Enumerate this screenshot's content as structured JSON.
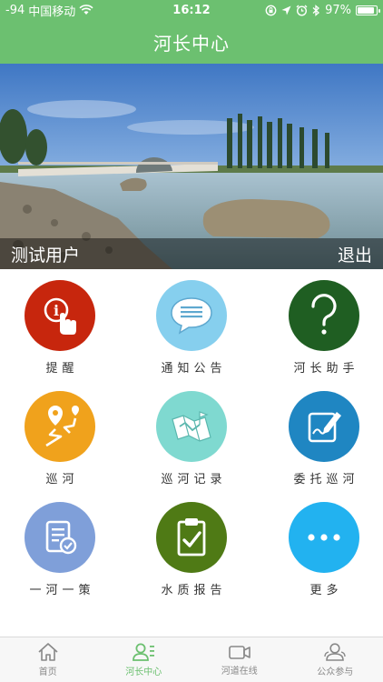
{
  "status_bar": {
    "signal": "-94",
    "carrier": "中国移动",
    "time": "16:12",
    "battery": "97%",
    "battery_level": 0.97
  },
  "header": {
    "title": "河长中心"
  },
  "banner": {
    "username": "测试用户",
    "logout_label": "退出"
  },
  "menu": [
    {
      "label": "提醒",
      "icon": "reminder-hand-icon",
      "color": "#c7260d"
    },
    {
      "label": "通知公告",
      "icon": "chat-bubble-icon",
      "color": "#86cfee"
    },
    {
      "label": "河长助手",
      "icon": "question-mark-icon",
      "color": "#1f5e22"
    },
    {
      "label": "巡河",
      "icon": "route-map-icon",
      "color": "#f0a21c"
    },
    {
      "label": "巡河记录",
      "icon": "folded-map-icon",
      "color": "#7fd9d0"
    },
    {
      "label": "委托巡河",
      "icon": "edit-note-icon",
      "color": "#1f86c2"
    },
    {
      "label": "一河一策",
      "icon": "checklist-icon",
      "color": "#7f9fd9"
    },
    {
      "label": "水质报告",
      "icon": "clipboard-check-icon",
      "color": "#4f7a15"
    },
    {
      "label": "更多",
      "icon": "more-dots-icon",
      "color": "#22b2f0"
    }
  ],
  "tabs": [
    {
      "label": "首页",
      "icon": "home-icon",
      "active": false
    },
    {
      "label": "河长中心",
      "icon": "user-list-icon",
      "active": true
    },
    {
      "label": "河道在线",
      "icon": "video-camera-icon",
      "active": false
    },
    {
      "label": "公众参与",
      "icon": "people-icon",
      "active": false
    }
  ],
  "colors": {
    "primary": "#6cc070",
    "inactive": "#888888"
  }
}
